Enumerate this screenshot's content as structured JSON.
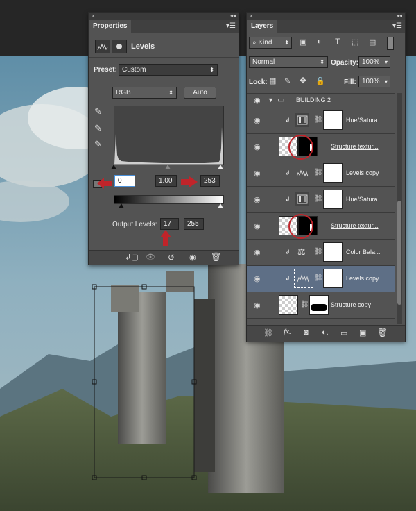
{
  "properties_panel": {
    "tab_label": "Properties",
    "adjustment_name": "Levels",
    "preset_label": "Preset:",
    "preset_value": "Custom",
    "channel_value": "RGB",
    "auto_label": "Auto",
    "input_black": "0",
    "input_gamma": "1.00",
    "input_white": "253",
    "output_levels_label": "Output Levels:",
    "output_black": "17",
    "output_white": "255"
  },
  "layers_panel": {
    "tab_label": "Layers",
    "filter_kind": "Kind",
    "blend_mode": "Normal",
    "opacity_label": "Opacity:",
    "opacity_value": "100%",
    "lock_label": "Lock:",
    "fill_label": "Fill:",
    "fill_value": "100%",
    "group_name": "BUILDING 2",
    "layers": [
      {
        "name": "Hue/Satura...",
        "type": "hue"
      },
      {
        "name": "Structure textur...",
        "type": "pixel"
      },
      {
        "name": "Levels copy",
        "type": "levels"
      },
      {
        "name": "Hue/Satura...",
        "type": "hue"
      },
      {
        "name": "Structure textur...",
        "type": "pixel"
      },
      {
        "name": "Color Bala...",
        "type": "colorbal"
      },
      {
        "name": "Levels copy",
        "type": "levels"
      },
      {
        "name": "Structure copy",
        "type": "pixel"
      }
    ],
    "footer_icons": [
      "link-icon",
      "fx-icon",
      "mask-icon",
      "adjustment-icon",
      "folder-icon",
      "new-layer-icon",
      "trash-icon"
    ]
  },
  "colors": {
    "panel_bg": "#535353",
    "selected_row": "#5e6f86",
    "annotation_red": "#c0242a"
  }
}
